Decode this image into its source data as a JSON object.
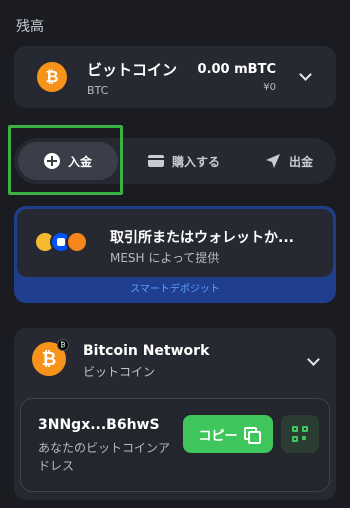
{
  "balance": {
    "section_label": "残高",
    "coin_symbol": "₿",
    "coin_name": "ビットコイン",
    "ticker": "BTC",
    "amount": "0.00 mBTC",
    "fiat": "¥0"
  },
  "actions": {
    "deposit": "入金",
    "buy": "購入する",
    "withdraw": "出金"
  },
  "mesh": {
    "title": "取引所またはウォレットか...",
    "subtitle": "MESH によって提供",
    "link": "スマートデポジット"
  },
  "network": {
    "name": "Bitcoin Network",
    "sub": "ビットコイン",
    "badge": "₿",
    "address": "3NNgx...B6hwS",
    "address_label": "あなたのビットコインアドレス",
    "copy_label": "コピー"
  },
  "colors": {
    "accent_green": "#3fc65c",
    "bitcoin_orange": "#f7931a",
    "mesh_blue": "#1f3f8e",
    "highlight_green": "#3cb043"
  }
}
